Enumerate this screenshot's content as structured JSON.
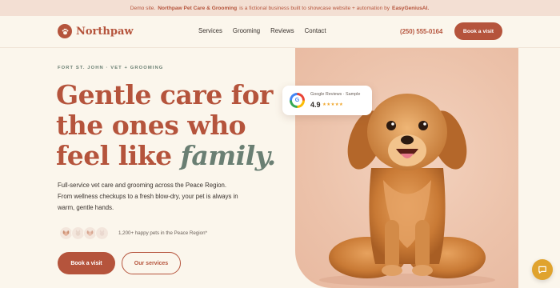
{
  "banner": {
    "prefix": "Demo site.",
    "business": "Northpaw Pet Care & Grooming",
    "middle": "is a fictional business built to showcase website + automation by",
    "credit": "EasyGeniusAI."
  },
  "nav": {
    "brand": "Northpaw",
    "links": [
      "Services",
      "Grooming",
      "Reviews",
      "Contact"
    ],
    "phone": "(250) 555-0164",
    "cta": "Book a visit"
  },
  "hero": {
    "eyebrow": "FORT ST. JOHN · VET + GROOMING",
    "headline_line1": "Gentle care for",
    "headline_line2": "the ones who",
    "headline_line3": "feel like",
    "headline_accent": "family.",
    "body": "Full-service vet care and grooming across the Peace Region. From wellness checkups to a fresh blow-dry, your pet is always in warm, gentle hands.",
    "social_proof": "1,200+ happy pets in the Peace Region*",
    "primary_cta": "Book a visit",
    "secondary_cta": "Our services"
  },
  "review_card": {
    "badge_letter": "G",
    "title": "Google Reviews · Sample",
    "score": "4.9",
    "stars": "★★★★★"
  },
  "colors": {
    "brand": "#b5543c",
    "accent": "#6a7f73",
    "background": "#fbf6ec",
    "banner_bg": "#f3dfd3",
    "chat": "#e0a32e"
  },
  "icons": {
    "logo": "paw-icon",
    "chat": "chat-bubble-icon",
    "pets": [
      "dog-avatar-icon",
      "cat-avatar-icon",
      "dog-avatar-icon",
      "cat-avatar-icon"
    ]
  }
}
